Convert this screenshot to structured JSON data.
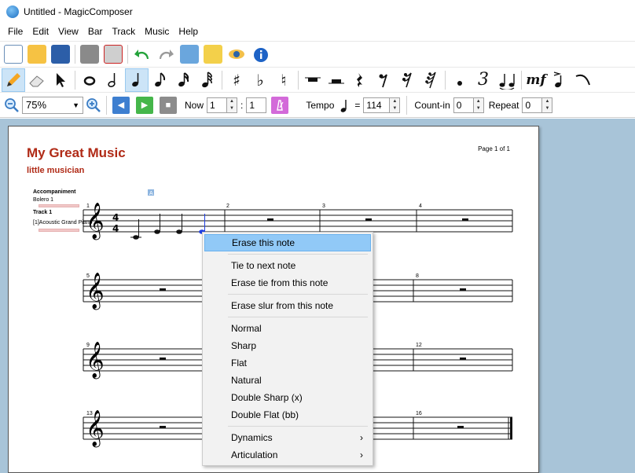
{
  "window": {
    "title": "Untitled - MagicComposer"
  },
  "menu": [
    "File",
    "Edit",
    "View",
    "Bar",
    "Track",
    "Music",
    "Help"
  ],
  "toolbar3": {
    "zoom": "75%",
    "now_label": "Now",
    "now_bar": "1",
    "now_beat": "1",
    "tempo_label": "Tempo",
    "tempo_value": "114",
    "countin_label": "Count-in",
    "countin_value": "0",
    "repeat_label": "Repeat",
    "repeat_value": "0"
  },
  "document": {
    "title": "My Great Music",
    "composer": "little musician",
    "page_info": "Page 1 of 1",
    "tracks": {
      "accompaniment_label": "Accompaniment",
      "accompaniment_instrument": "Bolero 1",
      "track1_label": "Track 1",
      "track1_instrument": "[1]Acoustic Grand Piano"
    },
    "bar_numbers": [
      "1",
      "2",
      "3",
      "4",
      "5",
      "8",
      "9",
      "12",
      "13",
      "16"
    ],
    "marker": "A"
  },
  "context_menu": {
    "erase_note": "Erase this note",
    "tie_next": "Tie to next note",
    "erase_tie": "Erase tie from this note",
    "erase_slur": "Erase slur from this note",
    "normal": "Normal",
    "sharp": "Sharp",
    "flat": "Flat",
    "natural": "Natural",
    "double_sharp": "Double Sharp (x)",
    "double_flat": "Double Flat (bb)",
    "dynamics": "Dynamics",
    "articulation": "Articulation"
  }
}
